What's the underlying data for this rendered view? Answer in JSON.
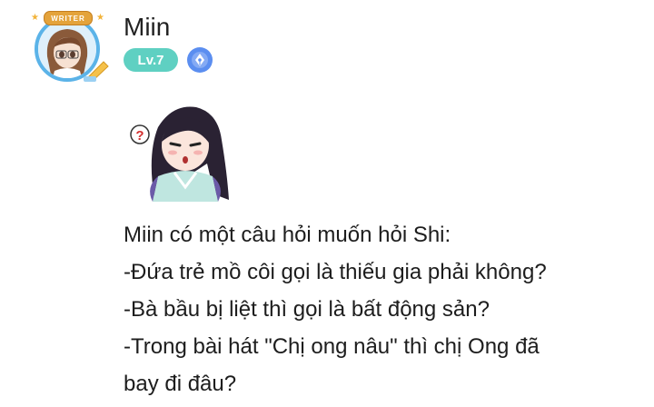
{
  "post": {
    "author": {
      "name": "Miin",
      "level": "Lv.7",
      "avatar_badge": "WRITER",
      "role_icon": "pen-nib-icon"
    },
    "sticker": "confused-anime-girl-sticker",
    "message_lines": [
      "Miin có một câu hỏi muốn hỏi Shi:",
      "-Đứa trẻ mồ côi gọi là thiếu gia phải không?",
      "-Bà bầu bị liệt thì gọi là bất động sản?",
      "-Trong bài hát \"Chị ong nâu\" thì chị Ong đã",
      "bay đi đâu?"
    ]
  },
  "colors": {
    "level_badge": "#5fd0c2",
    "role_badge": "#5b8ef0",
    "avatar_ring": "#5bb3e8",
    "writer_tag": "#e4a33b"
  }
}
